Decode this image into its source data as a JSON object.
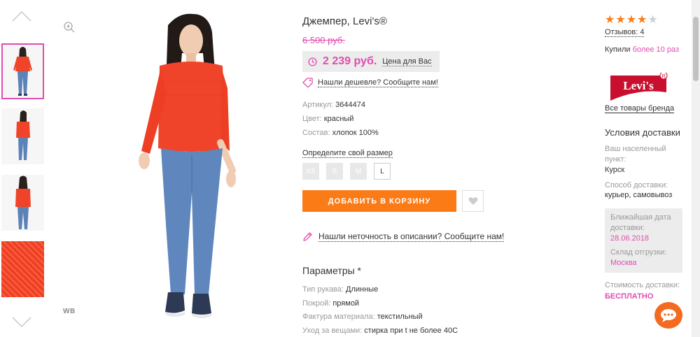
{
  "gallery": {
    "thumbnails": [
      {
        "alt": "model-front-view"
      },
      {
        "alt": "model-side-view"
      },
      {
        "alt": "model-back-view"
      },
      {
        "alt": "fabric-closeup"
      }
    ],
    "watermark": "WB"
  },
  "product": {
    "title": "Джемпер, Levi's®",
    "old_price": "6 500 руб.",
    "price": "2 239 руб.",
    "price_label": "Цена для Вас",
    "cheaper_link": "Нашли дешевле? Сообщите нам!",
    "attributes": [
      {
        "key": "Артикул:",
        "value": "3644474"
      },
      {
        "key": "Цвет:",
        "value": "красный"
      },
      {
        "key": "Состав:",
        "value": "хлопок 100%"
      }
    ],
    "size_link": "Определите свой размер",
    "sizes": [
      {
        "label": "XS",
        "available": false
      },
      {
        "label": "S",
        "available": false
      },
      {
        "label": "M",
        "available": false
      },
      {
        "label": "L",
        "available": true
      }
    ],
    "add_to_cart": "ДОБАВИТЬ В КОРЗИНУ",
    "inaccuracy_link": "Нашли неточность в описании? Сообщите нам!",
    "params_title": "Параметры *",
    "params": [
      {
        "key": "Тип рукава:",
        "value": "Длинные"
      },
      {
        "key": "Покрой:",
        "value": "прямой"
      },
      {
        "key": "Фактура материала:",
        "value": "текстильный"
      },
      {
        "key": "Уход за вещами:",
        "value": "стирка при t не более 40С"
      }
    ]
  },
  "sidebar": {
    "rating": 4,
    "rating_max": 5,
    "reviews": "Отзывов: 4",
    "bought_prefix": "Купили ",
    "bought_highlight": "более 10 раз",
    "brand_logo_text": "Levi's",
    "brand_link": "Все товары бренда",
    "delivery_title": "Условия доставки",
    "locality_label": "Ваш населенный пункт:",
    "locality_value": "Курск",
    "method_label": "Способ доставки:",
    "method_value": "курьер, самовывоз",
    "nearest_date_label": "Ближайшая дата доставки:",
    "nearest_date_value": "28.06.2018",
    "warehouse_label": "Склад отгрузки:",
    "warehouse_value": "Москва",
    "cost_label": "Стоимость доставки:",
    "cost_value": "БЕСПЛАТНО"
  },
  "colors": {
    "accent_orange": "#fb7b16",
    "accent_pink": "#e04db0",
    "price_box_bg": "#ececec"
  }
}
